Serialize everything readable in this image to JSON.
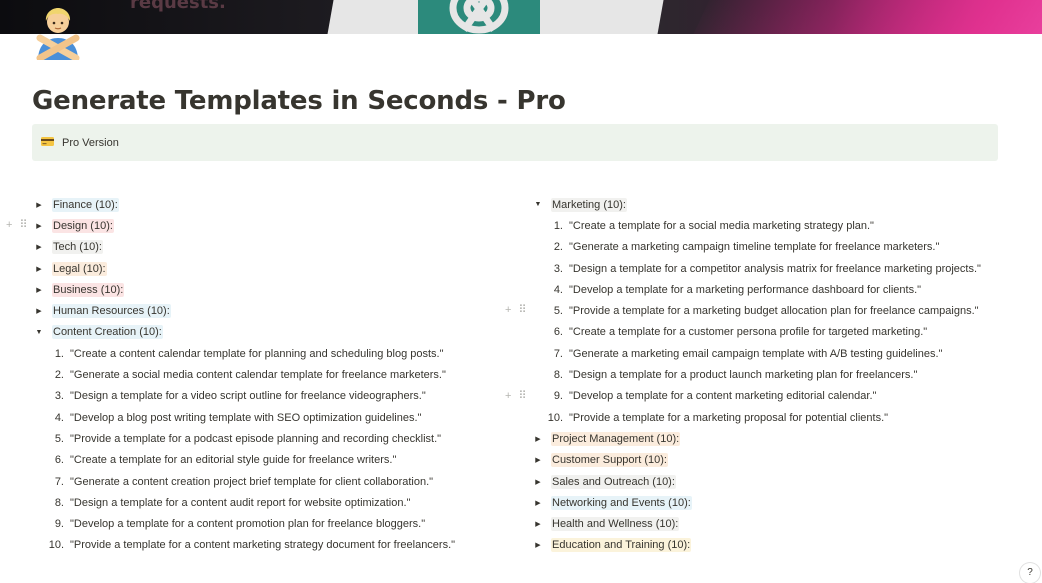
{
  "cover": {
    "text": "requests."
  },
  "page_icon": "person-gesturing-no-icon",
  "title": "Generate Templates in Seconds - Pro",
  "callout": {
    "icon": "credit-card-icon",
    "text": "Pro Version"
  },
  "left_column": {
    "toggles": [
      {
        "label": "Finance (10):",
        "color": "blue",
        "expanded": false
      },
      {
        "label": "Design (10):",
        "color": "red",
        "expanded": false
      },
      {
        "label": "Tech (10):",
        "color": "gray",
        "expanded": false
      },
      {
        "label": "Legal (10):",
        "color": "orange",
        "expanded": false
      },
      {
        "label": "Business (10):",
        "color": "red",
        "expanded": false
      },
      {
        "label": "Human Resources (10):",
        "color": "blue",
        "expanded": false
      },
      {
        "label": "Content Creation (10):",
        "color": "blue",
        "expanded": true
      }
    ],
    "content_creation_items": [
      {
        "num": "1.",
        "text": "\"Create a content calendar template for planning and scheduling blog posts.\""
      },
      {
        "num": "2.",
        "text": "\"Generate a social media content calendar template for freelance marketers.\""
      },
      {
        "num": "3.",
        "text": "\"Design a template for a video script outline for freelance videographers.\""
      },
      {
        "num": "4.",
        "text": "\"Develop a blog post writing template with SEO optimization guidelines.\""
      },
      {
        "num": "5.",
        "text": "\"Provide a template for a podcast episode planning and recording checklist.\""
      },
      {
        "num": "6.",
        "text": "\"Create a template for an editorial style guide for freelance writers.\""
      },
      {
        "num": "7.",
        "text": "\"Generate a content creation project brief template for client collaboration.\""
      },
      {
        "num": "8.",
        "text": "\"Design a template for a content audit report for website optimization.\""
      },
      {
        "num": "9.",
        "text": "\"Develop a template for a content promotion plan for freelance bloggers.\""
      },
      {
        "num": "10.",
        "text": "\"Provide a template for a content marketing strategy document for freelancers.\""
      }
    ]
  },
  "right_column": {
    "marketing_toggle": {
      "label": "Marketing (10):",
      "color": "gray",
      "expanded": true
    },
    "marketing_items": [
      {
        "num": "1.",
        "text": "\"Create a template for a social media marketing strategy plan.\""
      },
      {
        "num": "2.",
        "text": "\"Generate a marketing campaign timeline template for freelance marketers.\""
      },
      {
        "num": "3.",
        "text": "\"Design a template for a competitor analysis matrix for freelance marketing projects.\""
      },
      {
        "num": "4.",
        "text": "\"Develop a template for a marketing performance dashboard for clients.\""
      },
      {
        "num": "5.",
        "text": "\"Provide a template for a marketing budget allocation plan for freelance campaigns.\""
      },
      {
        "num": "6.",
        "text": "\"Create a template for a customer persona profile for targeted marketing.\""
      },
      {
        "num": "7.",
        "text": "\"Generate a marketing email campaign template with A/B testing guidelines.\""
      },
      {
        "num": "8.",
        "text": "\"Design a template for a product launch marketing plan for freelancers.\""
      },
      {
        "num": "9.",
        "text": "\"Develop a template for a content marketing editorial calendar.\""
      },
      {
        "num": "10.",
        "text": "\"Provide a template for a marketing proposal for potential clients.\""
      }
    ],
    "toggles": [
      {
        "label": "Project Management (10):",
        "color": "orange",
        "expanded": false
      },
      {
        "label": "Customer Support (10):",
        "color": "orange",
        "expanded": false
      },
      {
        "label": "Sales and Outreach (10):",
        "color": "gray",
        "expanded": false
      },
      {
        "label": "Networking and Events (10):",
        "color": "blue",
        "expanded": false
      },
      {
        "label": "Health and Wellness (10):",
        "color": "gray",
        "expanded": false
      },
      {
        "label": "Education and Training (10):",
        "color": "yellow",
        "expanded": false
      }
    ]
  },
  "help_button": "?",
  "colors": {
    "blue": "#e7f3f8",
    "red": "#fbe4e4",
    "orange": "#fbecdd",
    "yellow": "#fbf3db",
    "gray": "#f1f1ef",
    "callout_bg": "#edf3ec"
  }
}
